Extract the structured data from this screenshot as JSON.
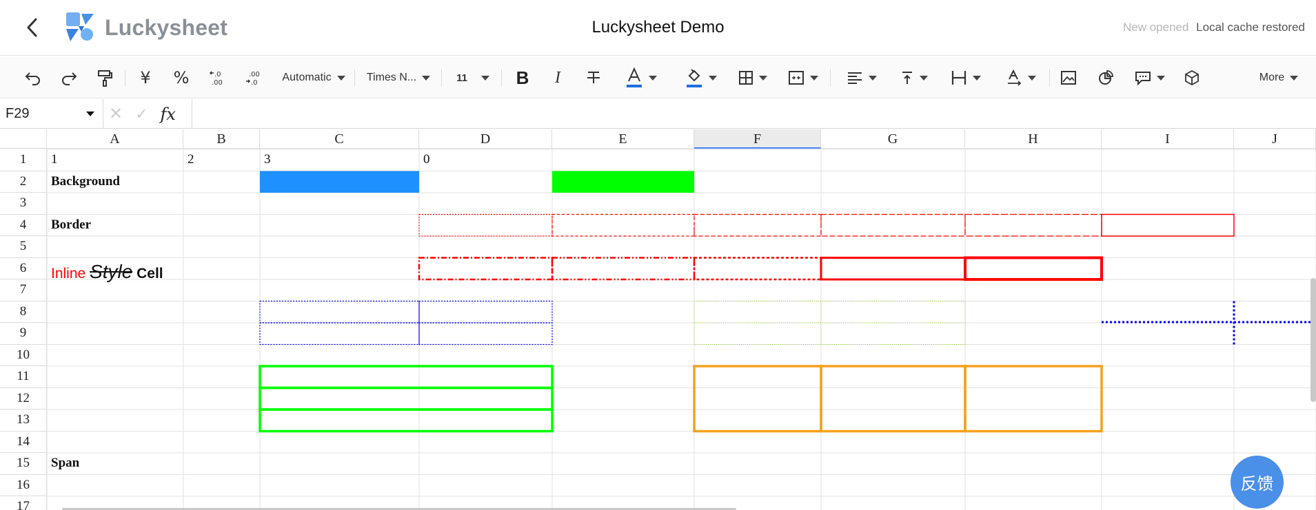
{
  "header": {
    "logo_text": "Luckysheet",
    "title": "Luckysheet Demo",
    "status_new": "New opened",
    "status_cache": "Local cache restored"
  },
  "toolbar": {
    "number_format": "Automatic",
    "font_family": "Times N...",
    "font_size": "11",
    "more_label": "More",
    "currency_symbol": "¥",
    "percent_symbol": "%",
    "bold_glyph": "B",
    "italic_glyph": "I",
    "text_color": "#1e6fe0",
    "fill_color": "#1e6fe0",
    "icons": [
      "undo-icon",
      "redo-icon",
      "format-painter-icon",
      "currency-icon",
      "percent-icon",
      "decrease-decimal-icon",
      "increase-decimal-icon",
      "bold-icon",
      "italic-icon",
      "strikethrough-icon",
      "text-color-icon",
      "fill-color-icon",
      "border-icon",
      "merge-icon",
      "align-left-icon",
      "valign-top-icon",
      "text-wrap-icon",
      "text-rotate-icon",
      "image-icon",
      "chart-icon",
      "comment-icon",
      "cube-icon"
    ]
  },
  "formula_bar": {
    "cell_ref": "F29",
    "cancel_glyph": "✕",
    "confirm_glyph": "✓",
    "fx_label": "fx",
    "value": ""
  },
  "sheet": {
    "selected_column": "F",
    "columns": [
      "A",
      "B",
      "C",
      "D",
      "E",
      "F",
      "G",
      "H",
      "I",
      "J"
    ],
    "rows": [
      "1",
      "2",
      "3",
      "4",
      "5",
      "6",
      "7",
      "8",
      "9",
      "10",
      "11",
      "12",
      "13",
      "14",
      "15",
      "16",
      "17"
    ],
    "cells": {
      "A1": "1",
      "B1": "2",
      "C1": "3",
      "D1": "0",
      "A2": "Background",
      "A4": "Border",
      "A15": "Span"
    },
    "inline_style_cell": {
      "part1": "Inline ",
      "part2": "Style",
      "part3": " Cell",
      "part1_color": "#ff0000"
    },
    "background_colors": {
      "C2": "#1e90ff",
      "E2": "#00ff00"
    },
    "border_colors": {
      "red": "#ff0000",
      "blue": "#0000ff",
      "olive": "#9acd32",
      "green": "#00ff00",
      "orange": "#f5a11c"
    }
  },
  "feedback_button": "反馈"
}
